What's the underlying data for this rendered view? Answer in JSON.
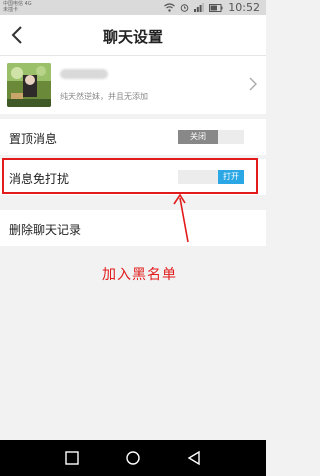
{
  "status_bar": {
    "carrier_line1": "中国电信 4G",
    "carrier_line2": "未插卡",
    "battery_percent": "61%",
    "time": "10:52"
  },
  "header": {
    "title": "聊天设置",
    "back_icon": "chevron-left-icon"
  },
  "profile": {
    "signature": "纯天然逆妹，并且无添加",
    "arrow_icon": "chevron-right-icon"
  },
  "settings": {
    "pin_label": "置顶消息",
    "pin_toggle_text": "关闭",
    "dnd_label": "消息免打扰",
    "dnd_toggle_text": "打开",
    "clear_label": "删除聊天记录"
  },
  "annotation": {
    "text": "加入黑名单",
    "color": "#e11b1b"
  },
  "colors": {
    "toggle_on": "#2aa7e4",
    "toggle_off": "#888888"
  }
}
